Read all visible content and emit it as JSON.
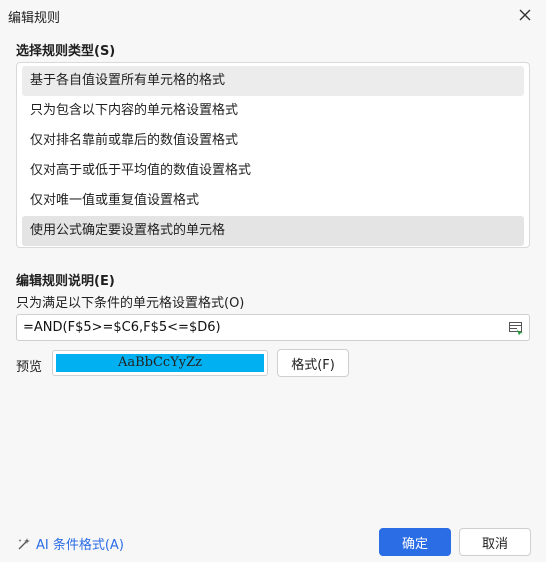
{
  "window": {
    "title": "编辑规则",
    "close_glyph": "✕"
  },
  "rule_type": {
    "heading": "选择规则类型(S)",
    "items": [
      {
        "label": "基于各自值设置所有单元格的格式",
        "state": "hover"
      },
      {
        "label": "只为包含以下内容的单元格设置格式",
        "state": "normal"
      },
      {
        "label": "仅对排名靠前或靠后的数值设置格式",
        "state": "normal"
      },
      {
        "label": "仅对高于或低于平均值的数值设置格式",
        "state": "normal"
      },
      {
        "label": "仅对唯一值或重复值设置格式",
        "state": "normal"
      },
      {
        "label": "使用公式确定要设置格式的单元格",
        "state": "selected"
      }
    ]
  },
  "rule_description": {
    "heading": "编辑规则说明(E)",
    "subtitle": "只为满足以下条件的单元格设置格式(O)",
    "formula": "=AND(F$5>=$C6,F$5<=$D6)",
    "range_icon": "range-select-icon"
  },
  "preview": {
    "label": "预览",
    "sample_text": "AaBbCcYyZz",
    "fill_color": "#00b0f0",
    "format_button": "格式(F)"
  },
  "footer": {
    "ai_link": "AI 条件格式(A)",
    "ok": "确定",
    "cancel": "取消"
  },
  "colors": {
    "accent": "#2b6de5",
    "background": "#f7f7f7"
  }
}
